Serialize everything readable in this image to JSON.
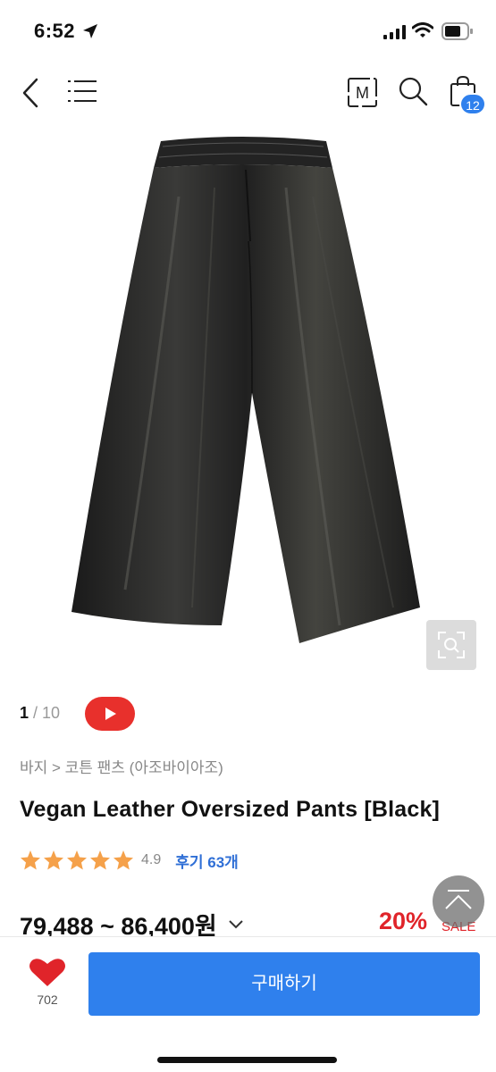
{
  "status_bar": {
    "time": "6:52"
  },
  "nav": {
    "cart_count": "12",
    "m_label": "M"
  },
  "gallery": {
    "current": "1",
    "separator": " / ",
    "total": "10"
  },
  "product": {
    "breadcrumb": "바지 > 코튼 팬츠 (아조바이아조)",
    "title": "Vegan Leather Oversized Pants [Black]",
    "rating": "4.9",
    "reviews_label": "후기 63개",
    "price_range": "79,488 ~ 86,400원",
    "discount": "20%",
    "sale_label": "SALE"
  },
  "bottom_bar": {
    "likes": "702",
    "buy_label": "구매하기"
  },
  "colors": {
    "accent": "#2f80ed",
    "sale": "#e0242a",
    "video": "#e8302c",
    "star": "#f5a14a"
  }
}
